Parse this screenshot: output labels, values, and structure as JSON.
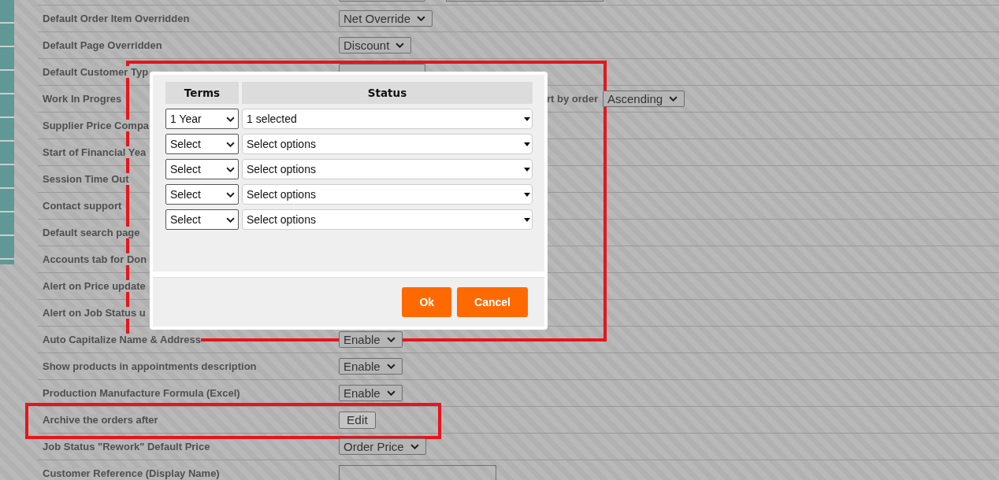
{
  "settings": [
    {
      "controls": [
        {
          "kind": "select"
        },
        {
          "kind": "input"
        }
      ]
    },
    {
      "label": "Default Order Item Overridden",
      "controls": [
        {
          "kind": "select",
          "value": "Net Override"
        }
      ]
    },
    {
      "label": "Default Page Overridden",
      "controls": [
        {
          "kind": "select",
          "value": "Discount"
        }
      ]
    },
    {
      "label": "Default Customer Typ",
      "controls": [
        {
          "kind": "select"
        }
      ]
    },
    {
      "label": "Work In Progres",
      "extra": {
        "label": "rt by order",
        "control": {
          "kind": "select",
          "value": "Ascending"
        }
      }
    },
    {
      "label": "Supplier Price Compa"
    },
    {
      "label": "Start of Financial Yea"
    },
    {
      "label": "Session Time Out"
    },
    {
      "label": "Contact support"
    },
    {
      "label": "Default search page"
    },
    {
      "label": "Accounts tab for Don"
    },
    {
      "label": "Alert on Price update"
    },
    {
      "label": "Alert on Job Status u"
    },
    {
      "label": "Auto Capitalize Name & Address",
      "controls": [
        {
          "kind": "select",
          "value": "Enable"
        }
      ]
    },
    {
      "label": "Show products in appointments description",
      "controls": [
        {
          "kind": "select",
          "value": "Enable"
        }
      ]
    },
    {
      "label": "Production Manufacture Formula (Excel)",
      "controls": [
        {
          "kind": "select",
          "value": "Enable"
        }
      ]
    },
    {
      "label": "Archive the orders after",
      "controls": [
        {
          "kind": "button",
          "value": "Edit"
        }
      ]
    },
    {
      "label": "Job Status \"Rework\" Default Price",
      "controls": [
        {
          "kind": "select",
          "value": "Order Price"
        }
      ]
    },
    {
      "label": "Customer Reference (Display Name)",
      "controls": [
        {
          "kind": "input"
        }
      ]
    }
  ],
  "dialog": {
    "columns": [
      "Terms",
      "Status"
    ],
    "rows": [
      {
        "term": "1 Year",
        "status": "1 selected"
      },
      {
        "term": "Select",
        "status": "Select options"
      },
      {
        "term": "Select",
        "status": "Select options"
      },
      {
        "term": "Select",
        "status": "Select options"
      },
      {
        "term": "Select",
        "status": "Select options"
      }
    ],
    "buttons": [
      "Ok",
      "Cancel"
    ]
  }
}
